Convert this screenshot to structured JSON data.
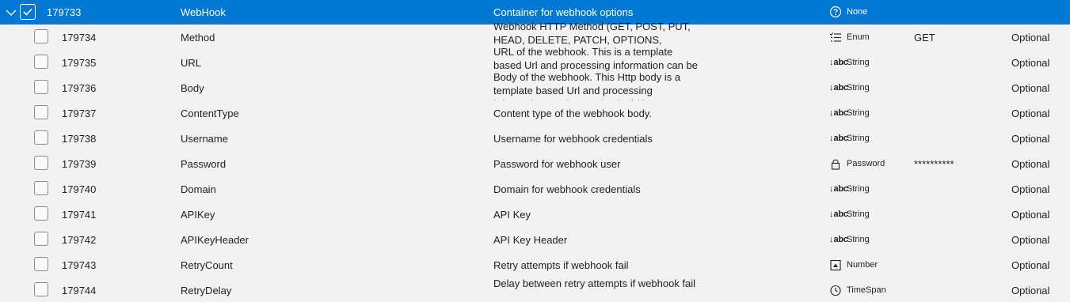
{
  "rows": [
    {
      "id": "179733",
      "name": "WebHook",
      "description": "Container for webhook options",
      "type": "None",
      "type_icon": "question-circle-icon",
      "value": "",
      "required": ""
    },
    {
      "id": "179734",
      "name": "Method",
      "description": "Webhook HTTP Method (GET, POST, PUT, HEAD, DELETE, PATCH, OPTIONS, CONNECT)",
      "type": "Enum",
      "type_icon": "enum-list-icon",
      "value": "GET",
      "required": "Optional"
    },
    {
      "id": "179735",
      "name": "URL",
      "description": "URL of the webhook. This is a template based Url and processing information can be used to build it",
      "type": "String",
      "type_icon": "abc-string-icon",
      "value": "",
      "required": "Optional"
    },
    {
      "id": "179736",
      "name": "Body",
      "description": "Body of the webhook. This Http body is a template based Url and processing information can be used to build it",
      "type": "String",
      "type_icon": "abc-string-icon",
      "value": "",
      "required": "Optional"
    },
    {
      "id": "179737",
      "name": "ContentType",
      "description": "Content type of the webhook body.",
      "type": "String",
      "type_icon": "abc-string-icon",
      "value": "",
      "required": "Optional"
    },
    {
      "id": "179738",
      "name": "Username",
      "description": "Username for webhook credentials",
      "type": "String",
      "type_icon": "abc-string-icon",
      "value": "",
      "required": "Optional"
    },
    {
      "id": "179739",
      "name": "Password",
      "description": "Password for webhook user",
      "type": "Password",
      "type_icon": "lock-icon",
      "value": "**********",
      "required": "Optional"
    },
    {
      "id": "179740",
      "name": "Domain",
      "description": "Domain for webhook credentials",
      "type": "String",
      "type_icon": "abc-string-icon",
      "value": "",
      "required": "Optional"
    },
    {
      "id": "179741",
      "name": "APIKey",
      "description": "API Key",
      "type": "String",
      "type_icon": "abc-string-icon",
      "value": "",
      "required": "Optional"
    },
    {
      "id": "179742",
      "name": "APIKeyHeader",
      "description": "API Key Header",
      "type": "String",
      "type_icon": "abc-string-icon",
      "value": "",
      "required": "Optional"
    },
    {
      "id": "179743",
      "name": "RetryCount",
      "description": "Retry attempts if webhook fail",
      "type": "Number",
      "type_icon": "number-icon",
      "value": "",
      "required": "Optional"
    },
    {
      "id": "179744",
      "name": "RetryDelay",
      "description": "Delay between retry attempts if webhook fail",
      "type": "TimeSpan",
      "type_icon": "clock-icon",
      "value": "",
      "required": "Optional"
    }
  ],
  "icons": {
    "abc_label": "abc"
  },
  "colors": {
    "selected_bg": "#0078d4",
    "row_bg": "#f2f2f2"
  }
}
